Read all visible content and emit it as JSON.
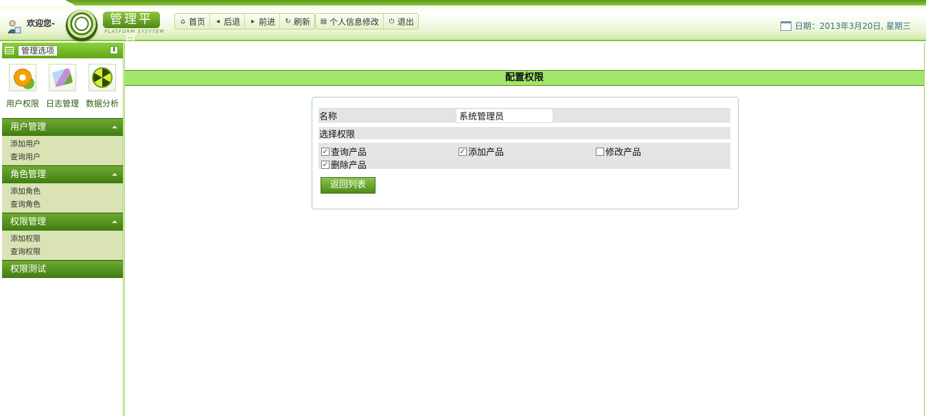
{
  "header": {
    "welcome": "欢迎您-",
    "logo_title": "管理平台",
    "logo_subtitle": "PLATFORM SYSYTEM",
    "nav": {
      "home": "首页",
      "back": "后退",
      "forward": "前进",
      "refresh": "刷新",
      "profile": "个人信息修改",
      "logout": "退出"
    },
    "date": "日期：2013年3月20日, 星期三"
  },
  "sidebar": {
    "title": "管理选项",
    "quick": [
      {
        "label": "用户权限",
        "icon": "gears-icon"
      },
      {
        "label": "日志管理",
        "icon": "log-icon"
      },
      {
        "label": "数据分析",
        "icon": "data-analysis-icon"
      }
    ],
    "groups": [
      {
        "title": "用户管理",
        "items": [
          "添加用户",
          "查询用户"
        ]
      },
      {
        "title": "角色管理",
        "items": [
          "添加角色",
          "查询角色"
        ]
      },
      {
        "title": "权限管理",
        "items": [
          "添加权限",
          "查询权限"
        ]
      },
      {
        "title": "权限测试",
        "items": []
      }
    ]
  },
  "main": {
    "title": "配置权限",
    "form": {
      "name_label": "名称",
      "name_value": "系统管理员",
      "perm_label": "选择权限",
      "permissions": [
        {
          "label": "查询产品",
          "checked": true
        },
        {
          "label": "添加产品",
          "checked": true
        },
        {
          "label": "修改产品",
          "checked": false
        },
        {
          "label": "删除产品",
          "checked": true
        }
      ],
      "back_button": "返回列表"
    }
  },
  "colors": {
    "brand_green": "#5ea818",
    "title_bar": "#a4e66c",
    "menu_items_bg": "#d9e3b4"
  }
}
